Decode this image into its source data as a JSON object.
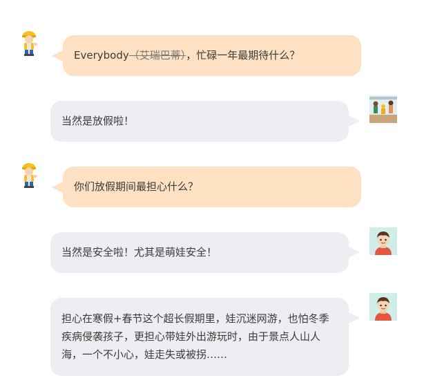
{
  "colors": {
    "left_bubble": "#fde1c2",
    "right_bubble": "#eceef1",
    "text": "#3a3a3a"
  },
  "messages": [
    {
      "side": "left",
      "avatar": "construction-kid-avatar-icon",
      "prefix": "Everybody",
      "struck": "（艾瑞巴蒂）",
      "suffix": "，忙碌一年最期待什么？"
    },
    {
      "side": "right",
      "avatar": "family-photo-avatar-icon",
      "text": "当然是放假啦！"
    },
    {
      "side": "left",
      "avatar": "construction-kid-avatar-icon",
      "text": "你们放假期间最担心什么？"
    },
    {
      "side": "right",
      "avatar": "boy-avatar-icon",
      "text": "当然是安全啦！尤其是萌娃安全！"
    },
    {
      "side": "right",
      "avatar": "boy-avatar-icon",
      "text": "担心在寒假+春节这个超长假期里，娃沉迷网游，也怕冬季疾病侵袭孩子，更担心带娃外出游玩时，由于景点人山人海，一个不小心，娃走失或被拐……"
    }
  ]
}
